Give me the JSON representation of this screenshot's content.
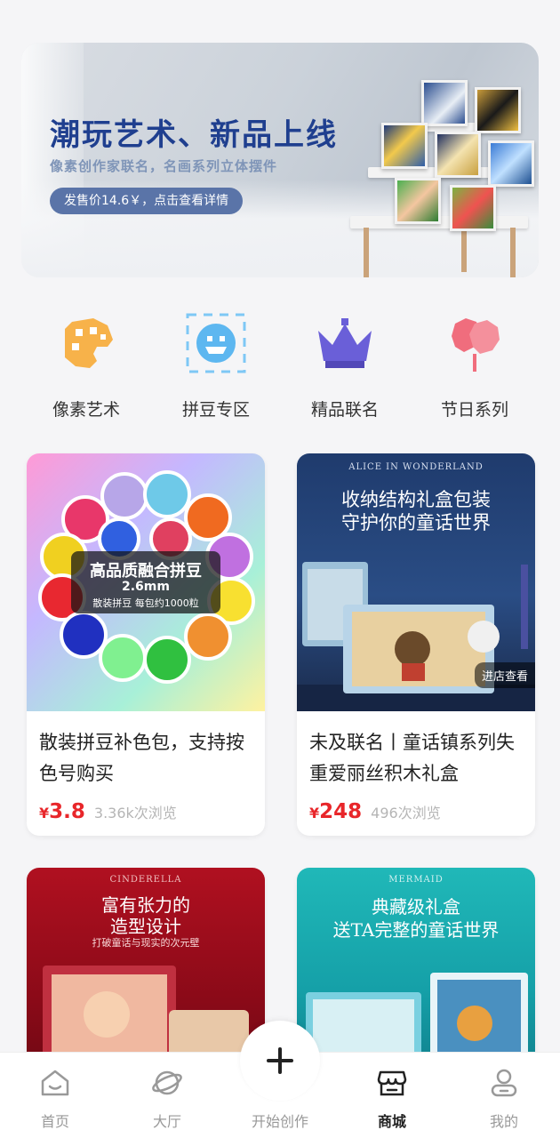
{
  "banner": {
    "title": "潮玩艺术、新品上线",
    "subtitle": "像素创作家联名，名画系列立体摆件",
    "pill": "发售价14.6￥，点击查看详情"
  },
  "categories": [
    {
      "label": "像素艺术",
      "icon": "palette-icon"
    },
    {
      "label": "拼豆专区",
      "icon": "smiley-icon"
    },
    {
      "label": "精品联名",
      "icon": "crown-icon"
    },
    {
      "label": "节日系列",
      "icon": "balloon-icon"
    }
  ],
  "products": [
    {
      "name": "散装拼豆补色包，支持按色号购买",
      "price_symbol": "¥",
      "price": "3.8",
      "views": "3.36k次浏览",
      "img_title": "高品质融合拼豆",
      "img_size": "2.6mm",
      "img_note": "散装拼豆 每包约1000粒"
    },
    {
      "name": "未及联名丨童话镇系列失重爱丽丝积木礼盒",
      "price_symbol": "¥",
      "price": "248",
      "views": "496次浏览",
      "img_brand": "ALICE IN WONDERLAND",
      "img_line1": "收纳结构礼盒包装",
      "img_line2": "守护你的童话世界",
      "img_tag": "进店查看"
    },
    {
      "img_brand": "CINDERELLA",
      "img_line1": "富有张力的",
      "img_line2": "造型设计",
      "img_line3": "打破童话与现实的次元壁"
    },
    {
      "img_brand": "MERMAID",
      "img_line1": "典藏级礼盒",
      "img_line2": "送TA完整的童话世界"
    }
  ],
  "nav": {
    "items": [
      {
        "label": "首页",
        "icon": "home-icon"
      },
      {
        "label": "大厅",
        "icon": "planet-icon"
      },
      {
        "label": "开始创作",
        "icon": "plus-icon"
      },
      {
        "label": "商城",
        "icon": "store-icon"
      },
      {
        "label": "我的",
        "icon": "user-icon"
      }
    ],
    "active": "商城"
  },
  "colors": {
    "accent": "#1f3f8f",
    "price": "#e8262a",
    "pill": "#5a74a8"
  }
}
